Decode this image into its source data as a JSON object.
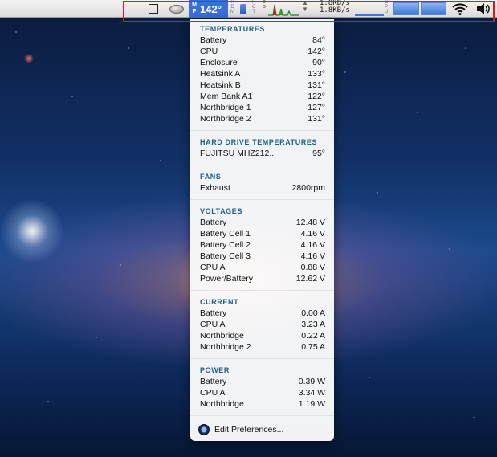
{
  "menubar": {
    "temperature": "142°",
    "mp_label": [
      "M",
      "P"
    ],
    "hdm_label": [
      "H",
      "D",
      "M"
    ],
    "hct_label": [
      "H",
      "C",
      "T"
    ],
    "upload_rate": "1.8KB/s",
    "download_rate": "1.8KB/s",
    "cpu_label": [
      "C",
      "P",
      "U"
    ],
    "icons": [
      "square-icon",
      "drive-icon",
      "battery-icon",
      "cpu-graph-icon",
      "wifi-icon",
      "volume-icon"
    ]
  },
  "menu": {
    "temperatures": {
      "title": "TEMPERATURES",
      "rows": [
        {
          "label": "Battery",
          "value": "84°"
        },
        {
          "label": "CPU",
          "value": "142°"
        },
        {
          "label": "Enclosure",
          "value": "90°"
        },
        {
          "label": "Heatsink A",
          "value": "133°"
        },
        {
          "label": "Heatsink B",
          "value": "131°"
        },
        {
          "label": "Mem Bank A1",
          "value": "122°"
        },
        {
          "label": "Northbridge 1",
          "value": "127°"
        },
        {
          "label": "Northbridge 2",
          "value": "131°"
        }
      ]
    },
    "hard_drive": {
      "title": "HARD DRIVE TEMPERATURES",
      "rows": [
        {
          "label": "FUJITSU MHZ212...",
          "value": "95°"
        }
      ]
    },
    "fans": {
      "title": "FANS",
      "rows": [
        {
          "label": "Exhaust",
          "value": "2800rpm"
        }
      ]
    },
    "voltages": {
      "title": "VOLTAGES",
      "rows": [
        {
          "label": "Battery",
          "value": "12.48 V"
        },
        {
          "label": "Battery Cell 1",
          "value": "4.16 V"
        },
        {
          "label": "Battery Cell 2",
          "value": "4.16 V"
        },
        {
          "label": "Battery Cell 3",
          "value": "4.16 V"
        },
        {
          "label": "CPU A",
          "value": "0.88 V"
        },
        {
          "label": "Power/Battery",
          "value": "12.62 V"
        }
      ]
    },
    "current": {
      "title": "CURRENT",
      "rows": [
        {
          "label": "Battery",
          "value": "0.00 A"
        },
        {
          "label": "CPU A",
          "value": "3.23 A"
        },
        {
          "label": "Northbridge",
          "value": "0.22 A"
        },
        {
          "label": "Northbridge 2",
          "value": "0.75 A"
        }
      ]
    },
    "power": {
      "title": "POWER",
      "rows": [
        {
          "label": "Battery",
          "value": "0.39 W"
        },
        {
          "label": "CPU A",
          "value": "3.34 W"
        },
        {
          "label": "Northbridge",
          "value": "1.19 W"
        }
      ]
    },
    "edit_preferences": "Edit Preferences..."
  },
  "colors": {
    "highlight_box": "#e3141b",
    "section_title": "#1f5e8a",
    "temp_badge_bg": "#3a6fd8"
  }
}
